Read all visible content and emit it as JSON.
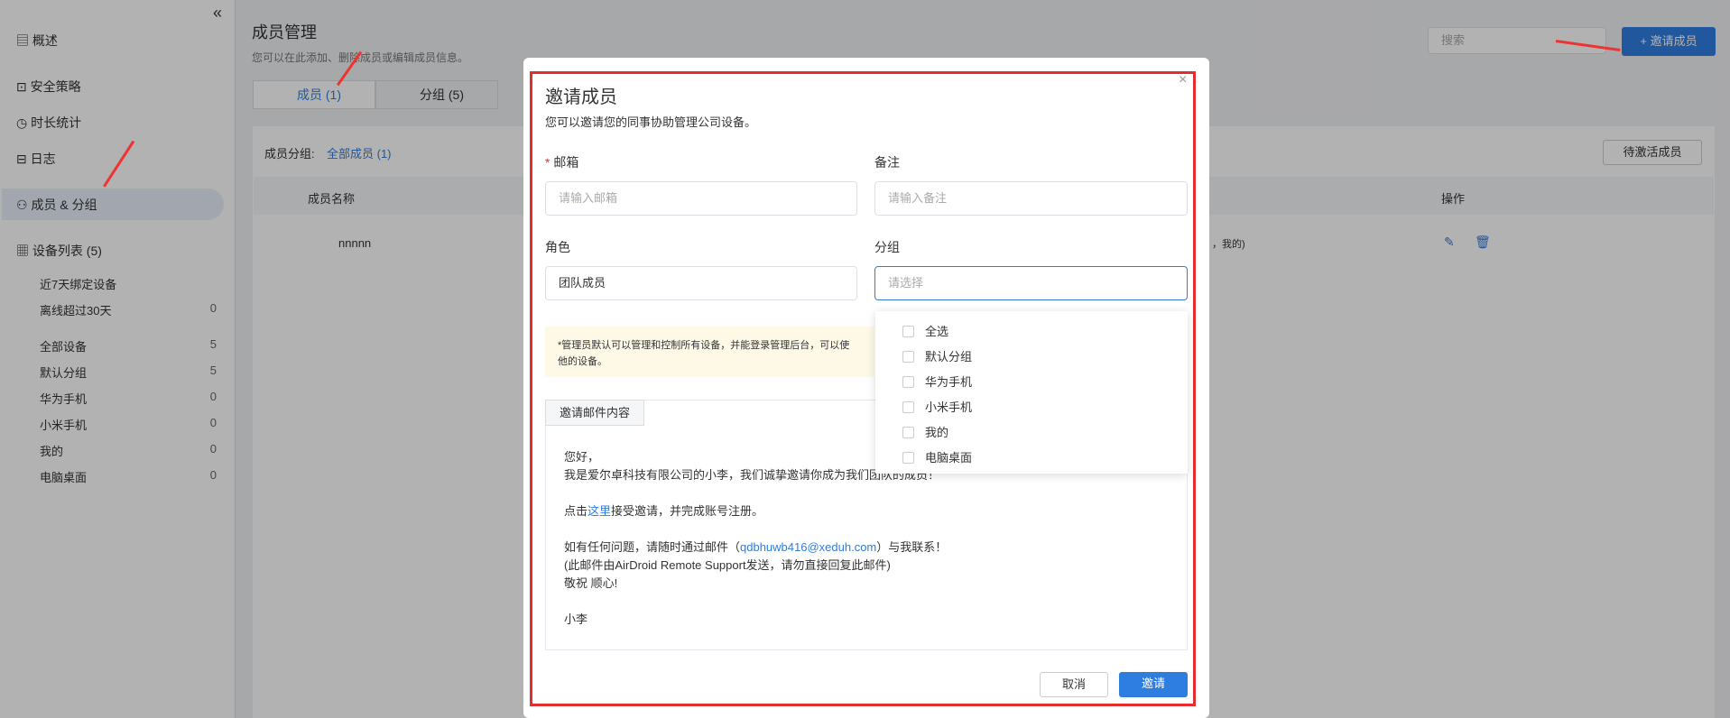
{
  "sidebar": {
    "items": [
      {
        "label": "概述"
      },
      {
        "label": "安全策略"
      },
      {
        "label": "时长统计"
      },
      {
        "label": "日志"
      },
      {
        "label": "成员 & 分组"
      },
      {
        "label": "设备列表 (5)"
      }
    ],
    "groups": [
      {
        "label": "近7天绑定设备",
        "count": ""
      },
      {
        "label": "离线超过30天",
        "count": "0"
      },
      {
        "label": "全部设备",
        "count": "5"
      },
      {
        "label": "默认分组",
        "count": "5"
      },
      {
        "label": "华为手机",
        "count": "0"
      },
      {
        "label": "小米手机",
        "count": "0"
      },
      {
        "label": "我的",
        "count": "0"
      },
      {
        "label": "电脑桌面",
        "count": "0"
      }
    ]
  },
  "header": {
    "title": "成员管理",
    "subtitle": "您可以在此添加、删除成员或编辑成员信息。",
    "search": "搜索",
    "invite": "+ 邀请成员",
    "tab1": "成员 (1)",
    "tab2": "分组 (5)"
  },
  "content": {
    "grp": "成员分组:",
    "grp_val": "全部成员 (1)",
    "pending": "待激活成员",
    "col_name": "成员名称",
    "col_op": "操作",
    "name": "nnnnn",
    "tail": "，我的)"
  },
  "modal": {
    "title": "邀请成员",
    "desc": "您可以邀请您的同事协助管理公司设备。",
    "email": "邮箱",
    "email_ph": "请输入邮箱",
    "note": "备注",
    "note_ph": "请输入备注",
    "role": "角色",
    "role_val": "团队成员",
    "group": "分组",
    "group_ph": "请选择",
    "notice": "*管理员默认可以管理和控制所有设备，并能登录管理后台，可以使",
    "notice2": "他的设备。",
    "email_tab": "邀请邮件内容",
    "m1": "您好，",
    "m2": "我是爱尔卓科技有限公司的小李，我们诚挚邀请你成为我们团队的成员！",
    "m3a": "点击",
    "m3b": "这里",
    "m3c": "接受邀请，并完成账号注册。",
    "m4a": "如有任何问题，请随时通过邮件（",
    "m4b": "qdbhuwb416@xeduh.com",
    "m4c": "）与我联系！",
    "m5": "(此邮件由AirDroid Remote Support发送，请勿直接回复此邮件)",
    "m6": "敬祝 顺心!",
    "m7": "小李",
    "cancel": "取消",
    "ok": "邀请",
    "dd": [
      "全选",
      "默认分组",
      "华为手机",
      "小米手机",
      "我的",
      "电脑桌面"
    ]
  }
}
